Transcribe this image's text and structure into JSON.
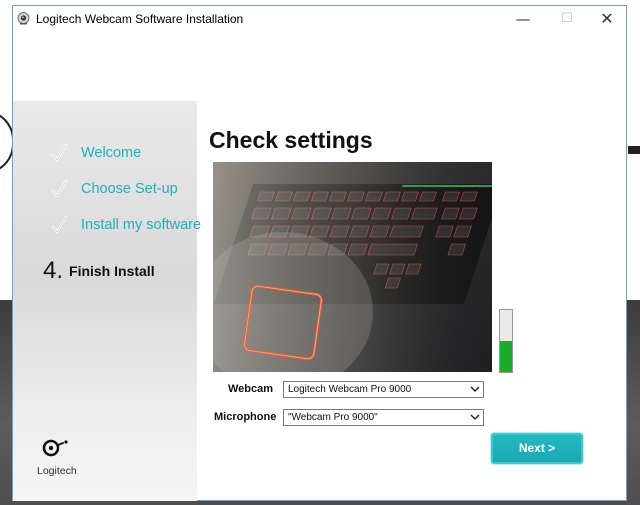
{
  "window": {
    "title": "Logitech Webcam Software Installation"
  },
  "title_buttons": {
    "minimize": "—",
    "maximize": "☐",
    "close": "✕"
  },
  "steps": [
    {
      "label": "Welcome",
      "done": true
    },
    {
      "label": "Choose Set-up",
      "done": true
    },
    {
      "label": "Install my software",
      "done": true
    },
    {
      "number": "4.",
      "label": "Finish Install",
      "current": true
    }
  ],
  "main": {
    "heading": "Check settings"
  },
  "meter": {
    "level": 0.5
  },
  "webcam": {
    "label": "Webcam",
    "value": "Logitech Webcam Pro 9000"
  },
  "microphone": {
    "label": "Microphone",
    "value": "\"Webcam Pro 9000\""
  },
  "next_button": {
    "label": "Next >"
  },
  "brand": {
    "name": "Logitech"
  },
  "colors": {
    "accent": "#1eb0bc",
    "meter_green": "#19ad2a",
    "button": "#22b9c2"
  }
}
